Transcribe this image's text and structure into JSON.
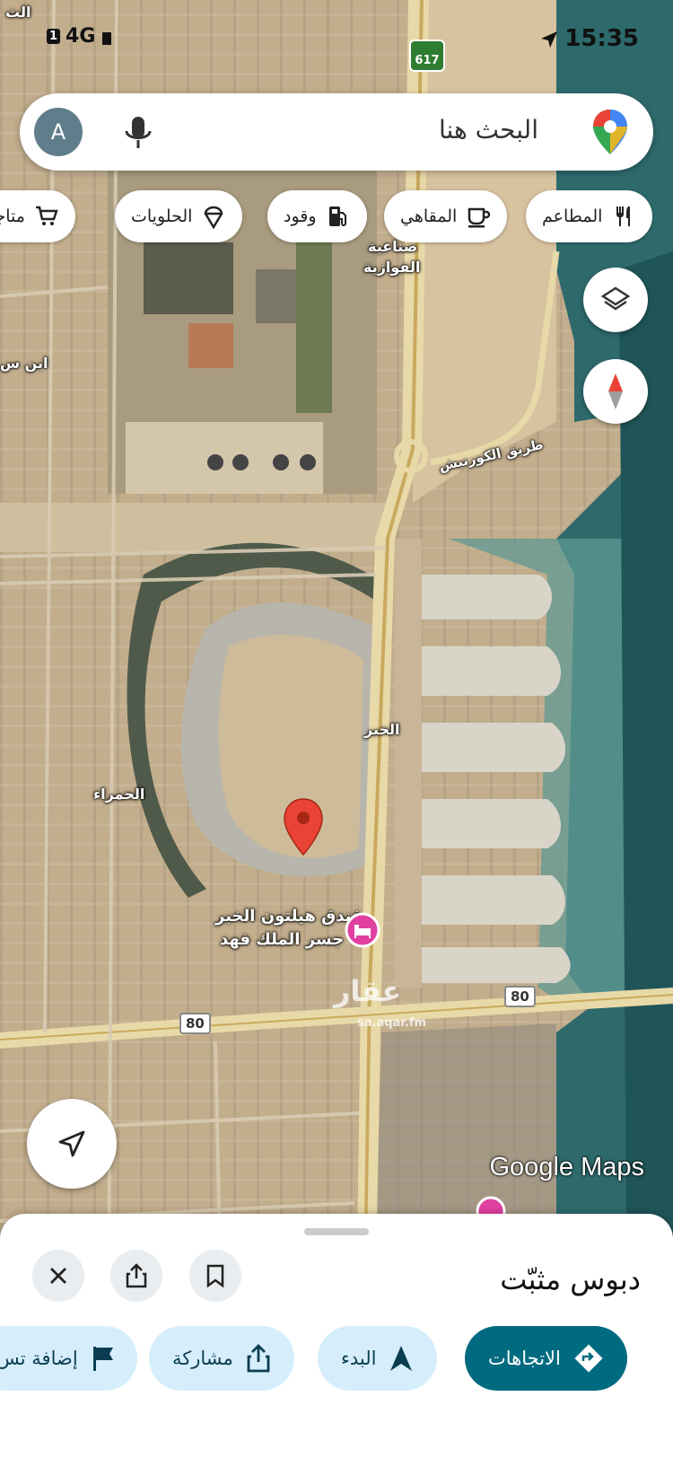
{
  "status_bar": {
    "time": "15:35",
    "sim": "1",
    "network": "4G"
  },
  "search": {
    "placeholder": "البحث هنا",
    "avatar_letter": "A"
  },
  "chips": [
    {
      "label": "المطاعم",
      "icon": "fork-knife-icon"
    },
    {
      "label": "المقاهي",
      "icon": "coffee-cup-icon"
    },
    {
      "label": "وقود",
      "icon": "gas-pump-icon"
    },
    {
      "label": "الحلويات",
      "icon": "ice-cream-icon"
    },
    {
      "label": "متاجر",
      "icon": "cart-icon"
    }
  ],
  "map": {
    "labels": {
      "industrial": "صناعية",
      "industrial2": "الفوازية",
      "ibn": "ابن س",
      "corniche": "طريق الكورنيش",
      "khobar": "الخبر",
      "hamra": "الحمراء",
      "hotel1": "فندق هيلتون الخبر",
      "hotel2": "جسر الملك فهد",
      "top_left": "الث"
    },
    "route_shield_top": "617",
    "route_80_left": "80",
    "route_80_right": "80",
    "watermark_ar": "عقار",
    "watermark_en": "sa.aqar.fm",
    "google_maps": "Google Maps",
    "colors": {
      "pin": "#ea4335",
      "hotel_pin": "#e040a0",
      "sea": "#2f6f73"
    }
  },
  "sheet": {
    "title": "دبوس مثبّت",
    "actions": [
      {
        "label": "الاتجاهات",
        "icon": "directions-icon",
        "primary": true
      },
      {
        "label": "البدء",
        "icon": "navigation-arrow-icon"
      },
      {
        "label": "مشاركة",
        "icon": "share-icon"
      },
      {
        "label": "إضافة تس",
        "icon": "flag-icon"
      }
    ]
  }
}
